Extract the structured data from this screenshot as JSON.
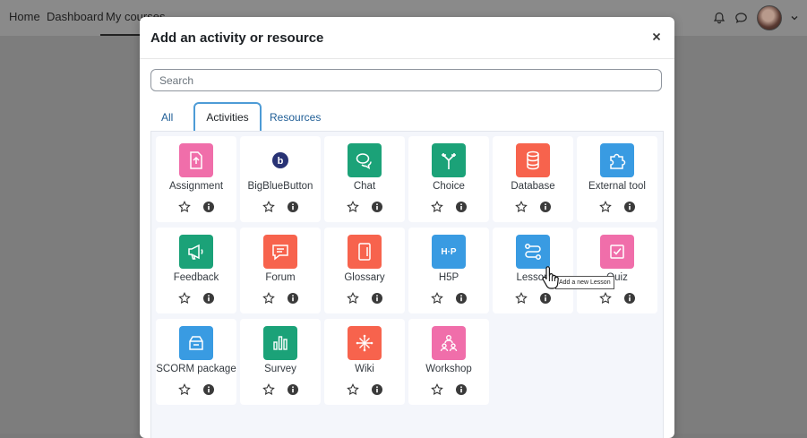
{
  "topnav": {
    "items": [
      {
        "label": "Home"
      },
      {
        "label": "Dashboard"
      },
      {
        "label": "My courses"
      }
    ]
  },
  "modal": {
    "title": "Add an activity or resource",
    "search_placeholder": "Search",
    "tabs": [
      {
        "label": "All"
      },
      {
        "label": "Activities",
        "active": true
      },
      {
        "label": "Resources"
      }
    ],
    "items": [
      {
        "label": "Assignment",
        "color": "#f06eaa",
        "icon": "assignment-icon"
      },
      {
        "label": "BigBlueButton",
        "color": "#ffffff",
        "icon": "bigbluebutton-icon"
      },
      {
        "label": "Chat",
        "color": "#1ba278",
        "icon": "chat-icon"
      },
      {
        "label": "Choice",
        "color": "#1ba278",
        "icon": "choice-icon"
      },
      {
        "label": "Database",
        "color": "#f7634d",
        "icon": "database-icon"
      },
      {
        "label": "External tool",
        "color": "#399be2",
        "icon": "external-tool-icon"
      },
      {
        "label": "Feedback",
        "color": "#1ba278",
        "icon": "feedback-icon"
      },
      {
        "label": "Forum",
        "color": "#f7634d",
        "icon": "forum-icon"
      },
      {
        "label": "Glossary",
        "color": "#f7634d",
        "icon": "glossary-icon"
      },
      {
        "label": "H5P",
        "color": "#399be2",
        "icon": "h5p-icon",
        "glyph": "H·P"
      },
      {
        "label": "Lesson",
        "color": "#399be2",
        "icon": "lesson-icon"
      },
      {
        "label": "Quiz",
        "color": "#f06eaa",
        "icon": "quiz-icon"
      },
      {
        "label": "SCORM package",
        "color": "#399be2",
        "icon": "scorm-icon"
      },
      {
        "label": "Survey",
        "color": "#1ba278",
        "icon": "survey-icon"
      },
      {
        "label": "Wiki",
        "color": "#f7634d",
        "icon": "wiki-icon"
      },
      {
        "label": "Workshop",
        "color": "#f06eaa",
        "icon": "workshop-icon"
      }
    ],
    "tooltip": "Add a new Lesson"
  }
}
